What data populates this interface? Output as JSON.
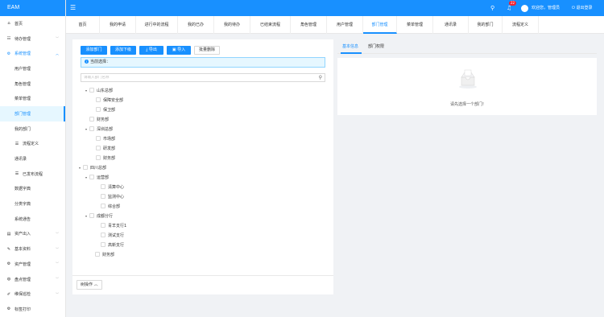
{
  "app": {
    "title": "EAM"
  },
  "header": {
    "badge_count": "22",
    "welcome": "欢迎您，管理员",
    "logout": "退出登录"
  },
  "sidebar": {
    "items": [
      {
        "label": "首页",
        "icon": "home-icon",
        "glyph": "⌂"
      },
      {
        "label": "待办管理",
        "icon": "todo-icon",
        "glyph": "☷",
        "chevron": "﹀"
      },
      {
        "label": "系统管理",
        "icon": "settings-icon",
        "glyph": "⚙",
        "chevron": "︿"
      },
      {
        "label": "用户管理"
      },
      {
        "label": "角色管理"
      },
      {
        "label": "菜单管理"
      },
      {
        "label": "部门管理"
      },
      {
        "label": "我的部门"
      },
      {
        "label": "流程定义",
        "icon": "list-icon",
        "glyph": "☰"
      },
      {
        "label": "通讯录"
      },
      {
        "label": "已发布流程",
        "icon": "list-icon",
        "glyph": "☰"
      },
      {
        "label": "数据字典"
      },
      {
        "label": "分类字典"
      },
      {
        "label": "系统通告"
      },
      {
        "label": "资产出入",
        "icon": "asset-io-icon",
        "glyph": "▤",
        "chevron": "﹀"
      },
      {
        "label": "基本资料",
        "icon": "edit-icon",
        "glyph": "✎",
        "chevron": "﹀"
      },
      {
        "label": "资产管理",
        "icon": "asset-icon",
        "glyph": "⚙",
        "chevron": "﹀"
      },
      {
        "label": "盘点管理",
        "icon": "inventory-icon",
        "glyph": "◍",
        "chevron": "﹀"
      },
      {
        "label": "维保巡检",
        "icon": "maintenance-icon",
        "glyph": "✐",
        "chevron": "﹀"
      },
      {
        "label": "标签打印",
        "icon": "print-icon",
        "glyph": "⚙"
      }
    ]
  },
  "tabs": [
    {
      "label": "首页"
    },
    {
      "label": "我的申请"
    },
    {
      "label": "进行中的流程"
    },
    {
      "label": "我的已办"
    },
    {
      "label": "我的待办"
    },
    {
      "label": "已结束流程"
    },
    {
      "label": "角色管理"
    },
    {
      "label": "用户管理"
    },
    {
      "label": "部门管理"
    },
    {
      "label": "菜单管理"
    },
    {
      "label": "通讯录"
    },
    {
      "label": "我的部门"
    },
    {
      "label": "流程定义"
    }
  ],
  "toolbar": {
    "add_dept": "添加部门",
    "add_sub": "添加下级",
    "export": "导出",
    "import": "导入",
    "batch_delete": "批量删除"
  },
  "alert": {
    "text": "当前选择："
  },
  "tree_search": {
    "placeholder": "请输入部门名称"
  },
  "tree": [
    {
      "label": "山东总部",
      "caret": "▾"
    },
    {
      "label": "保障安全部"
    },
    {
      "label": "保卫部"
    },
    {
      "label": "财务部"
    },
    {
      "label": "深圳总部",
      "caret": "▾"
    },
    {
      "label": "市场部"
    },
    {
      "label": "研发部"
    },
    {
      "label": "财务部"
    },
    {
      "label": "四川总部",
      "caret": "▾"
    },
    {
      "label": "运营部",
      "caret": "▾"
    },
    {
      "label": "清算中心"
    },
    {
      "label": "监测中心"
    },
    {
      "label": "综合部"
    },
    {
      "label": "成都分行",
      "caret": "▾"
    },
    {
      "label": "青羊支行1"
    },
    {
      "label": "测试支行"
    },
    {
      "label": "高新支行"
    },
    {
      "label": "财务部"
    }
  ],
  "tree_operation": {
    "label": "树操作"
  },
  "right_panel": {
    "tab_basic": "基本信息",
    "tab_permission": "部门权限",
    "empty_text": "请先选择一个部门!"
  },
  "colors": {
    "primary": "#1890ff",
    "badge": "#f5222d",
    "active_bg": "#e6f7ff"
  }
}
